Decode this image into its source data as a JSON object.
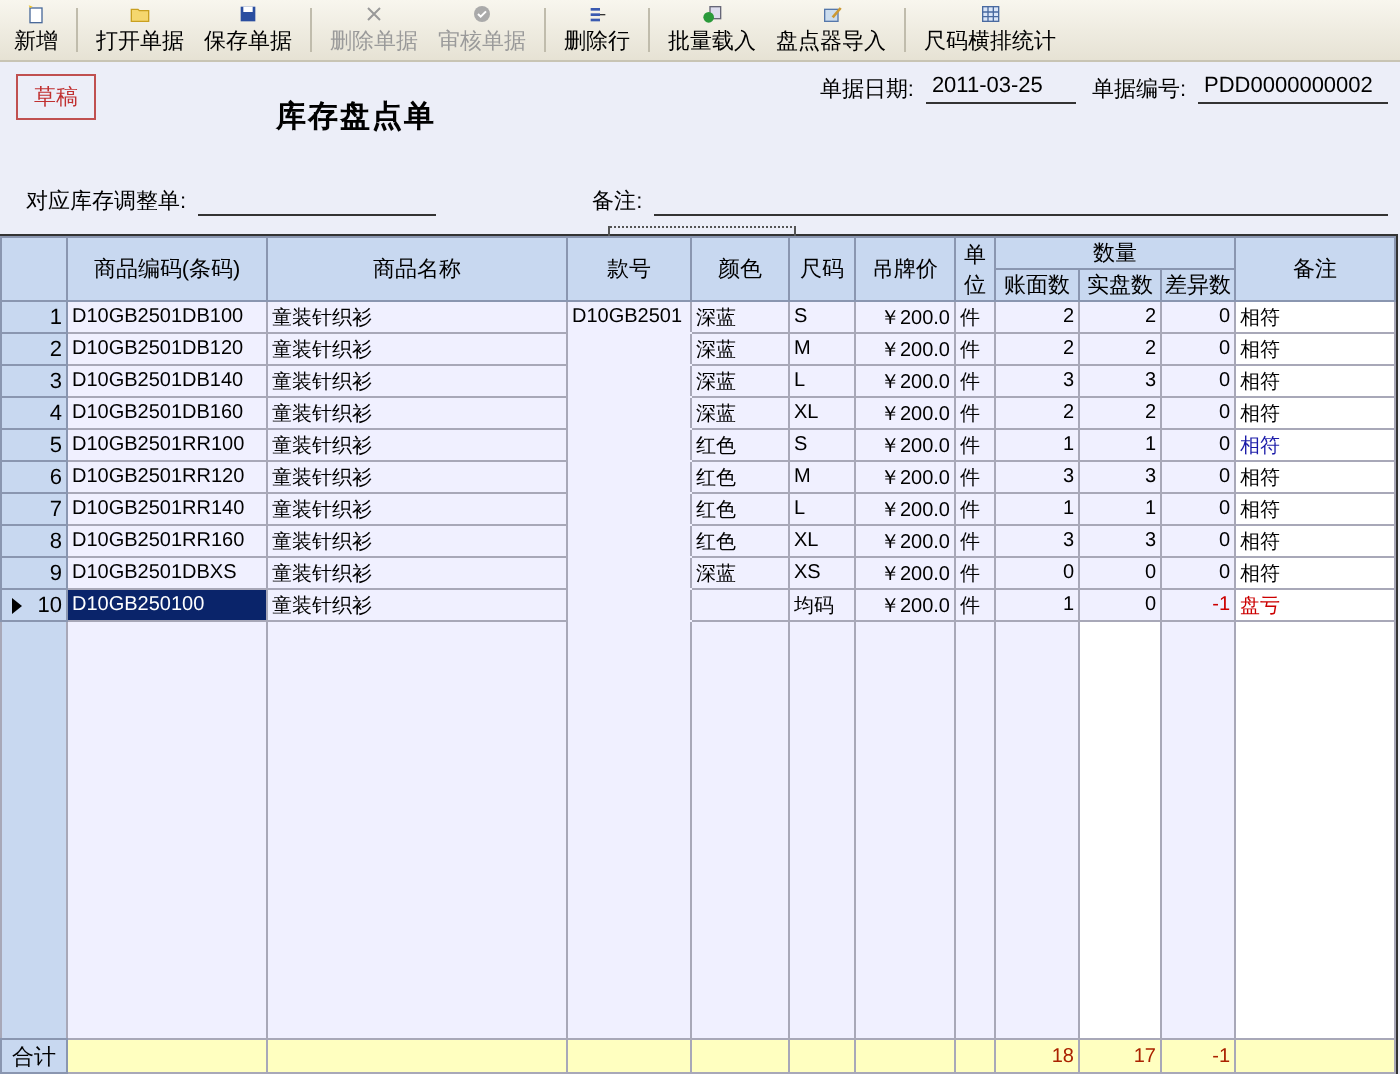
{
  "toolbar": [
    {
      "label": "新增",
      "disabled": false,
      "separator_after": true
    },
    {
      "label": "打开单据",
      "disabled": false,
      "separator_after": false
    },
    {
      "label": "保存单据",
      "disabled": false,
      "separator_after": true
    },
    {
      "label": "删除单据",
      "disabled": true,
      "separator_after": false
    },
    {
      "label": "审核单据",
      "disabled": true,
      "separator_after": true
    },
    {
      "label": "删除行",
      "disabled": false,
      "separator_after": true
    },
    {
      "label": "批量载入",
      "disabled": false,
      "separator_after": false
    },
    {
      "label": "盘点器导入",
      "disabled": false,
      "separator_after": true
    },
    {
      "label": "尺码横排统计",
      "disabled": false,
      "separator_after": false
    }
  ],
  "status_stamp": "草稿",
  "title": "库存盘点单",
  "fields": {
    "date_label": "单据日期:",
    "date": "2011-03-25",
    "number_label": "单据编号:",
    "number": "PDD0000000002",
    "adjust_label": "对应库存调整单:",
    "remark_label": "备注:"
  },
  "table": {
    "columns": [
      {
        "label": "商品编码(条码)"
      },
      {
        "label": "商品名称"
      },
      {
        "label": "款号"
      },
      {
        "label": "颜色"
      },
      {
        "label": "尺码"
      },
      {
        "label": "吊牌价"
      },
      {
        "label": "单位"
      }
    ],
    "group": {
      "label": "数量",
      "columns": [
        "账面数",
        "实盘数",
        "差异数"
      ]
    },
    "note_column": "备注",
    "rows": [
      {
        "no": "1",
        "code": "D10GB2501DB100",
        "name": "童装针织衫",
        "style": "D10GB2501",
        "color_name": "深蓝",
        "size": "S",
        "price": "￥200.0",
        "unit": "件",
        "book": "2",
        "actual": "2",
        "diff": "0",
        "note": "相符",
        "color": "#000000",
        "discrepancy": false,
        "selected": false
      },
      {
        "no": "2",
        "code": "D10GB2501DB120",
        "name": "童装针织衫",
        "color_name": "深蓝",
        "size": "M",
        "price": "￥200.0",
        "unit": "件",
        "book": "2",
        "actual": "2",
        "diff": "0",
        "note": "相符",
        "color": "#000000",
        "discrepancy": false,
        "selected": false
      },
      {
        "no": "3",
        "code": "D10GB2501DB140",
        "name": "童装针织衫",
        "color_name": "深蓝",
        "size": "L",
        "price": "￥200.0",
        "unit": "件",
        "book": "3",
        "actual": "3",
        "diff": "0",
        "note": "相符",
        "color": "#000000",
        "discrepancy": false,
        "selected": false
      },
      {
        "no": "4",
        "code": "D10GB2501DB160",
        "name": "童装针织衫",
        "color_name": "深蓝",
        "size": "XL",
        "price": "￥200.0",
        "unit": "件",
        "book": "2",
        "actual": "2",
        "diff": "0",
        "note": "相符",
        "color": "#000000",
        "discrepancy": false,
        "selected": false
      },
      {
        "no": "5",
        "code": "D10GB2501RR100",
        "name": "童装针织衫",
        "color_name": "红色",
        "size": "S",
        "price": "￥200.0",
        "unit": "件",
        "book": "1",
        "actual": "1",
        "diff": "0",
        "note": "相符",
        "color": "#1a1aa8",
        "discrepancy": false,
        "selected": false
      },
      {
        "no": "6",
        "code": "D10GB2501RR120",
        "name": "童装针织衫",
        "color_name": "红色",
        "size": "M",
        "price": "￥200.0",
        "unit": "件",
        "book": "3",
        "actual": "3",
        "diff": "0",
        "note": "相符",
        "color": "#000000",
        "discrepancy": false,
        "selected": false
      },
      {
        "no": "7",
        "code": "D10GB2501RR140",
        "name": "童装针织衫",
        "color_name": "红色",
        "size": "L",
        "price": "￥200.0",
        "unit": "件",
        "book": "1",
        "actual": "1",
        "diff": "0",
        "note": "相符",
        "color": "#000000",
        "discrepancy": false,
        "selected": false
      },
      {
        "no": "8",
        "code": "D10GB2501RR160",
        "name": "童装针织衫",
        "color_name": "红色",
        "size": "XL",
        "price": "￥200.0",
        "unit": "件",
        "book": "3",
        "actual": "3",
        "diff": "0",
        "note": "相符",
        "color": "#000000",
        "discrepancy": false,
        "selected": false
      },
      {
        "no": "9",
        "code": "D10GB2501DBXS",
        "name": "童装针织衫",
        "color_name": "深蓝",
        "size": "XS",
        "price": "￥200.0",
        "unit": "件",
        "book": "0",
        "actual": "0",
        "diff": "0",
        "note": "相符",
        "color": "#000000",
        "discrepancy": false,
        "selected": false
      },
      {
        "no": "10",
        "code": "D10GB250100",
        "name": "童装针织衫",
        "size": "均码",
        "price": "￥200.0",
        "unit": "件",
        "book": "1",
        "actual": "0",
        "diff": "-1",
        "note": "盘亏",
        "color": "#cc0000",
        "discrepancy": true,
        "selected": true
      }
    ],
    "totals": {
      "label": "合计",
      "book": "18",
      "actual": "17",
      "diff": "-1"
    }
  }
}
